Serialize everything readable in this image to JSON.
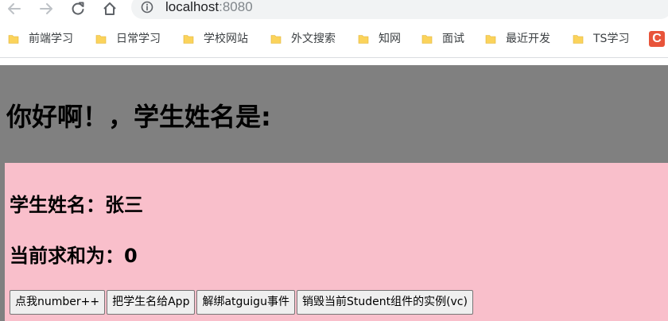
{
  "browser": {
    "url_host": "localhost",
    "url_port": ":8080",
    "bookmarks": [
      {
        "label": "前端学习",
        "icon": "folder-icon"
      },
      {
        "label": "日常学习",
        "icon": "folder-icon"
      },
      {
        "label": "学校网站",
        "icon": "folder-icon"
      },
      {
        "label": "外文搜索",
        "icon": "folder-icon"
      },
      {
        "label": "知网",
        "icon": "folder-icon"
      },
      {
        "label": "面试",
        "icon": "folder-icon"
      },
      {
        "label": "最近开发",
        "icon": "folder-icon"
      },
      {
        "label": "TS学习",
        "icon": "folder-icon"
      }
    ],
    "extra_app_letter": "C",
    "colors": {
      "folder": "#fbd35b",
      "extra_app": "#e8543a"
    }
  },
  "app": {
    "title": "你好啊！，学生姓名是:",
    "background": "#808080",
    "student": {
      "name_line": "学生姓名：张三",
      "sum_line": "当前求和为：0",
      "background": "#f9bfcb",
      "buttons": [
        {
          "label": "点我number++"
        },
        {
          "label": "把学生名给App"
        },
        {
          "label": "解绑atguigu事件"
        },
        {
          "label": "销毁当前Student组件的实例(vc)"
        }
      ]
    }
  }
}
